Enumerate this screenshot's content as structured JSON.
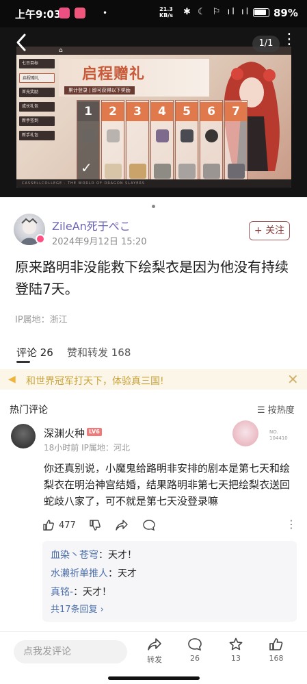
{
  "status_bar": {
    "time": "上午9:03",
    "net_speed_top": "21.3",
    "net_speed_bottom": "KB/s",
    "icons": "✱ ☾ ⚐ ıl ıl",
    "battery": "89%"
  },
  "viewer": {
    "page_count": "1/1",
    "game_title": "启程赠礼",
    "game_subtitle": "累计登录 | 即可获得以下奖励",
    "day_numbers": [
      "1",
      "2",
      "3",
      "4",
      "5",
      "6",
      "7"
    ],
    "menu_items": [
      "七日目标",
      "启程赠礼",
      "首充奖励",
      "成长礼包",
      "新手签到",
      "新手礼包"
    ],
    "footer_text": "CASSELLCOLLEGE · THE WORLD OF DRAGON SLAYERS"
  },
  "post": {
    "author_name": "ZileAn死于ぺこ",
    "date": "2024年9月12日 15:20",
    "follow_label": "+ 关注",
    "text": "原来路明非没能救下绘梨衣是因为他没有持续登陆7天。",
    "ip_location": "IP属地：浙江"
  },
  "tabs": {
    "comments": "评论 26",
    "likes_shares": "赞和转发 168"
  },
  "ad": {
    "text": "和世界冠军打天下，体验真三国!",
    "close": "✕"
  },
  "comments_header": {
    "title": "热门评论",
    "sort_label": "☰ 按热度"
  },
  "comment": {
    "name": "深渊火种",
    "level": "LV6",
    "meta": "18小时前   IP属地：河北",
    "deco_no": "NO.",
    "deco_num": "104410",
    "text": "你还真别说，小魔鬼给路明非安排的剧本是第七天和绘梨衣在明治神宫结婚，结果路明非第七天把绘梨衣送回蛇歧八家了，可不就是第七天没登录嘛",
    "like_count": "477"
  },
  "replies": [
    {
      "author": "血染丶苍穹",
      "text": "：天才！"
    },
    {
      "author": "水濑祈单推人",
      "text": "：天才"
    },
    {
      "author": "真铭-",
      "text": "：天才！"
    }
  ],
  "replies_more": "共17条回复 ›",
  "bottom_bar": {
    "input_placeholder": "点我发评论",
    "share_label": "转发",
    "comment_count": "26",
    "favorite_count": "13",
    "like_count": "168"
  },
  "colors": {
    "author_name": "#6a63b5",
    "reply_author": "#4b6fa8",
    "ad_text": "#c8a23a",
    "follow_border": "#a35a5a"
  }
}
